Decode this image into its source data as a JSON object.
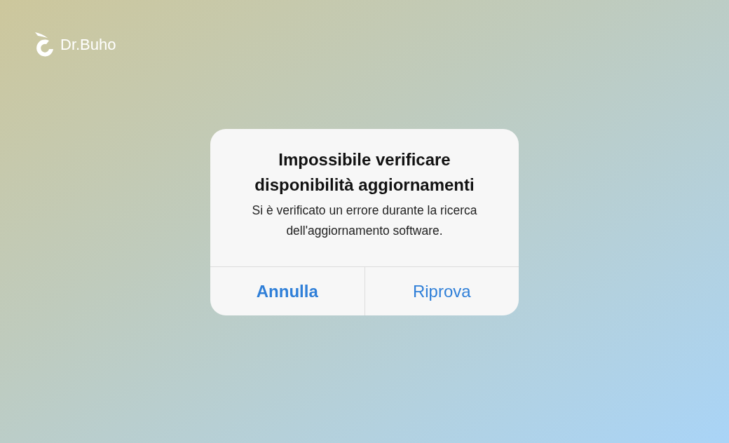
{
  "logo": {
    "text": "Dr.Buho"
  },
  "alert": {
    "title": "Impossibile verificare disponibilità aggiornamenti",
    "message": "Si è verificato un errore durante la ricerca dell'aggiornamento software.",
    "buttons": [
      {
        "label": "Annulla",
        "emphasized": true
      },
      {
        "label": "Riprova",
        "emphasized": false
      }
    ]
  }
}
